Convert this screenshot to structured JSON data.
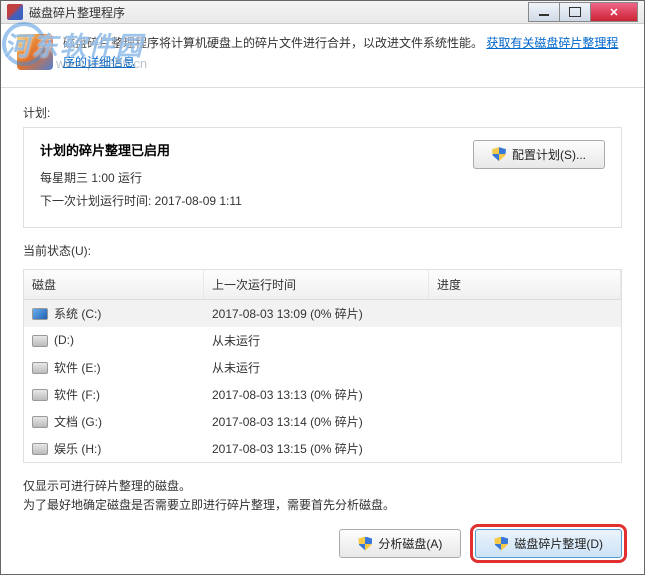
{
  "window": {
    "title": "磁盘碎片整理程序"
  },
  "header": {
    "description_prefix": "磁盘碎片整理程序将计算机硬盘上的碎片文件进行合并，以改进文件系统性能。",
    "link_text": "获取有关磁盘碎片整理程序的详细信息"
  },
  "plan": {
    "section_label": "计划:",
    "title": "计划的碎片整理已启用",
    "schedule_line": "每星期三  1:00 运行",
    "next_run_line": "下一次计划运行时间: 2017-08-09 1:11",
    "configure_btn": "配置计划(S)..."
  },
  "status": {
    "section_label": "当前状态(U):",
    "columns": {
      "disk": "磁盘",
      "last_run": "上一次运行时间",
      "progress": "进度"
    },
    "rows": [
      {
        "icon": "win",
        "name": "系统 (C:)",
        "last": "2017-08-03 13:09 (0% 碎片)",
        "selected": true
      },
      {
        "icon": "hdd",
        "name": "(D:)",
        "last": "从未运行"
      },
      {
        "icon": "hdd",
        "name": "软件 (E:)",
        "last": "从未运行"
      },
      {
        "icon": "hdd",
        "name": "软件 (F:)",
        "last": "2017-08-03 13:13 (0% 碎片)"
      },
      {
        "icon": "hdd",
        "name": "文档 (G:)",
        "last": "2017-08-03 13:14 (0% 碎片)"
      },
      {
        "icon": "hdd",
        "name": "娱乐 (H:)",
        "last": "2017-08-03 13:15 (0% 碎片)"
      }
    ]
  },
  "footer": {
    "line1": "仅显示可进行碎片整理的磁盘。",
    "line2": "为了最好地确定磁盘是否需要立即进行碎片整理，需要首先分析磁盘。",
    "analyze_btn": "分析磁盘(A)",
    "defrag_btn": "磁盘碎片整理(D)"
  },
  "watermark": {
    "text": "河东软件园",
    "sub": "www.pc0359.cn"
  }
}
